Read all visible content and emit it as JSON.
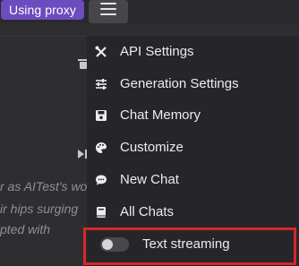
{
  "header": {
    "proxy_badge": "Using proxy",
    "menu_icon": "hamburger-icon"
  },
  "colors": {
    "badge": "#6c4dbf",
    "menu_bg": "#26262a",
    "highlight": "#d8262c"
  },
  "chat": {
    "lines": [
      "r as AITest's wo",
      "ir hips surging",
      "pted with"
    ],
    "icons": [
      "trash-icon",
      "skip-icon"
    ]
  },
  "menu": {
    "items": [
      {
        "label": "API Settings",
        "icon": "wrench-screwdriver-icon"
      },
      {
        "label": "Generation Settings",
        "icon": "sliders-icon"
      },
      {
        "label": "Chat Memory",
        "icon": "floppy-disk-icon"
      },
      {
        "label": "Customize",
        "icon": "palette-icon"
      },
      {
        "label": "New Chat",
        "icon": "chat-bubble-icon"
      },
      {
        "label": "All Chats",
        "icon": "book-icon"
      }
    ],
    "streaming_toggle": {
      "label": "Text streaming",
      "enabled": false
    }
  }
}
